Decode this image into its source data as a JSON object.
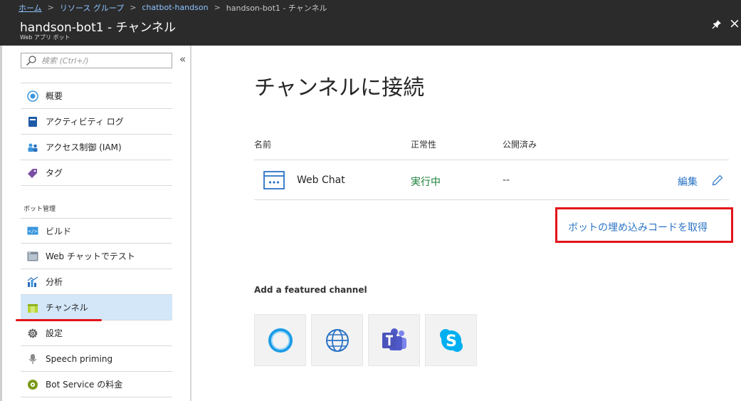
{
  "breadcrumb": {
    "items": [
      "ホーム",
      "リソース グループ",
      "chatbot-handson",
      "handson-bot1 - チャンネル"
    ]
  },
  "header": {
    "title": "handson-bot1 - チャンネル",
    "subtitle": "Web アプリ ボット"
  },
  "sidebar": {
    "search_placeholder": "検索 (Ctrl+/)",
    "collapse_label": "«",
    "items": [
      {
        "label": "概要",
        "icon": "info-icon"
      },
      {
        "label": "アクティビティ ログ",
        "icon": "activity-log-icon"
      },
      {
        "label": "アクセス制御 (IAM)",
        "icon": "users-icon"
      },
      {
        "label": "タグ",
        "icon": "tag-icon"
      }
    ],
    "section_label": "ボット管理",
    "bot_items": [
      {
        "label": "ビルド",
        "icon": "code-icon"
      },
      {
        "label": "Web チャットでテスト",
        "icon": "webchat-test-icon"
      },
      {
        "label": "分析",
        "icon": "analytics-icon"
      },
      {
        "label": "チャンネル",
        "icon": "channels-icon",
        "selected": true
      },
      {
        "label": "設定",
        "icon": "gear-icon"
      },
      {
        "label": "Speech priming",
        "icon": "microphone-icon"
      },
      {
        "label": "Bot Service の料金",
        "icon": "pricing-icon"
      }
    ]
  },
  "main": {
    "heading": "チャンネルに接続",
    "columns": {
      "name": "名前",
      "health": "正常性",
      "published": "公開済み"
    },
    "channels": [
      {
        "name": "Web Chat",
        "status": "実行中",
        "published": "--",
        "edit": "編集"
      }
    ],
    "embed_link": "ボットの埋め込みコードを取得",
    "featured_label": "Add a featured channel",
    "featured_channels": [
      "cortana-icon",
      "web-globe-icon",
      "teams-icon",
      "skype-icon"
    ]
  },
  "colors": {
    "accent_blue": "#2a73c5",
    "running_green": "#188038",
    "highlight_red": "#e3131b",
    "selected_bg": "#d3e7f9",
    "titlebar_bg": "#2b2b2b"
  }
}
